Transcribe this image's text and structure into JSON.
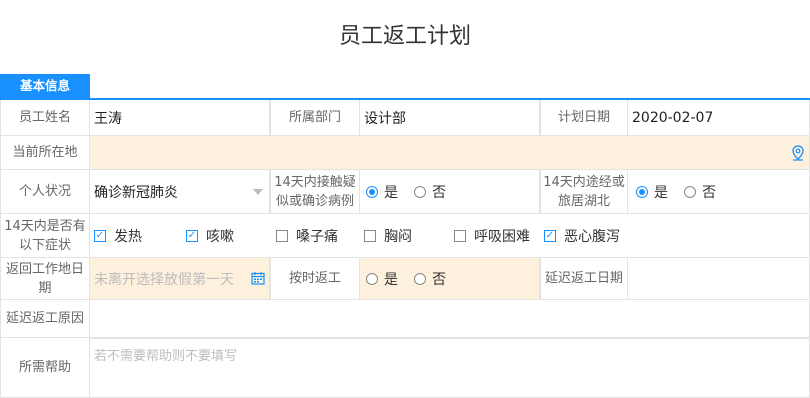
{
  "page": {
    "title": "员工返工计划"
  },
  "section": {
    "tab_label": "基本信息"
  },
  "fields": {
    "employee_name": {
      "label": "员工姓名",
      "value": "王涛"
    },
    "department": {
      "label": "所属部门",
      "value": "设计部"
    },
    "plan_date": {
      "label": "计划日期",
      "value": "2020-02-07"
    },
    "current_location": {
      "label": "当前所在地",
      "value": ""
    },
    "personal_status": {
      "label": "个人状况",
      "value": "确诊新冠肺炎"
    },
    "contact_14d": {
      "label": "14天内接触疑似或确诊病例",
      "yes": "是",
      "no": "否",
      "selected": "是"
    },
    "via_hubei_14d": {
      "label": "14天内途经或旅居湖北",
      "yes": "是",
      "no": "否",
      "selected": "是"
    },
    "symptoms": {
      "label": "14天内是否有以下症状",
      "items": [
        {
          "label": "发热",
          "checked": true
        },
        {
          "label": "咳嗽",
          "checked": true
        },
        {
          "label": "嗓子痛",
          "checked": false
        },
        {
          "label": "胸闷",
          "checked": false
        },
        {
          "label": "呼吸困难",
          "checked": false
        },
        {
          "label": "恶心腹泻",
          "checked": true
        }
      ]
    },
    "return_work_date": {
      "label": "返回工作地日期",
      "placeholder": "未离开选择放假第一天"
    },
    "on_time_return": {
      "label": "按时返工",
      "yes": "是",
      "no": "否",
      "selected": ""
    },
    "delayed_return_date": {
      "label": "延迟返工日期",
      "value": ""
    },
    "delay_reason": {
      "label": "延迟返工原因",
      "value": ""
    },
    "help_needed": {
      "label": "所需帮助",
      "placeholder": "若不需要帮助则不要填写"
    }
  },
  "colors": {
    "accent": "#1890ff",
    "highlight_bg": "#fdf0dc",
    "border": "#e3e3e3"
  },
  "icons": {
    "location": "location-pin-icon",
    "calendar": "calendar-icon"
  }
}
